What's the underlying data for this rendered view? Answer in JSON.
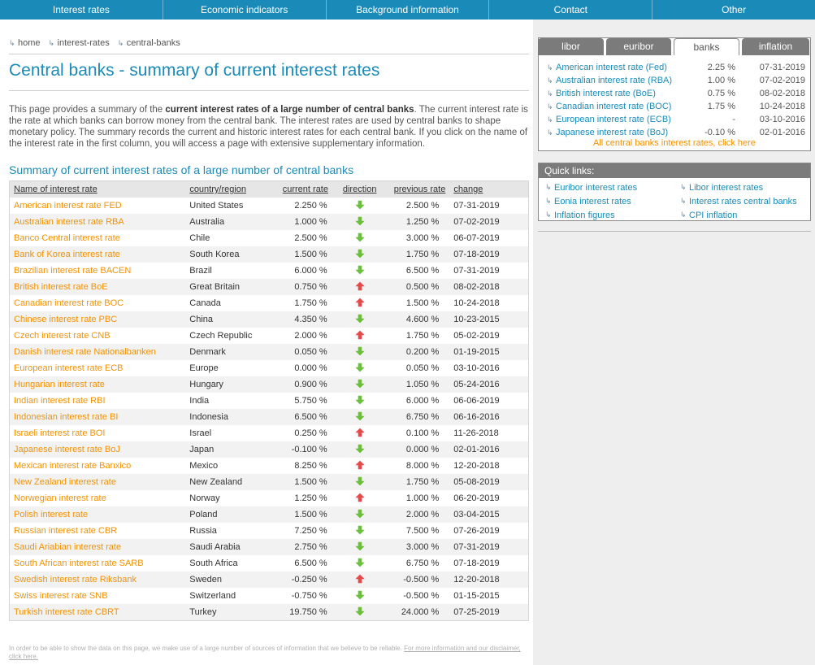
{
  "nav": [
    "Interest rates",
    "Economic indicators",
    "Background information",
    "Contact",
    "Other"
  ],
  "breadcrumb": [
    "home",
    "interest-rates",
    "central-banks"
  ],
  "page_title": "Central banks - summary of current interest rates",
  "intro": {
    "p1": "This page provides a summary of the ",
    "b1": "current interest rates of a large number of central banks",
    "p2": ". The current interest rate is the rate at which banks can borrow money from the central bank. The interest rates are used by central banks to shape monetary policy. The summary records the current and historic interest rates for each central bank. If you click on the name of the interest rate in the first column, you will access a page with extensive supplementary information."
  },
  "section_title": "Summary of current interest rates of a large number of central banks",
  "table": {
    "headers": [
      "Name of interest rate",
      "country/region",
      "current rate",
      "direction",
      "previous rate",
      "change"
    ],
    "rows": [
      {
        "name": "American interest rate FED",
        "country": "United States",
        "current": "2.250 %",
        "dir": "down",
        "previous": "2.500 %",
        "change": "07-31-2019"
      },
      {
        "name": "Australian interest rate RBA",
        "country": "Australia",
        "current": "1.000 %",
        "dir": "down",
        "previous": "1.250 %",
        "change": "07-02-2019"
      },
      {
        "name": "Banco Central interest rate",
        "country": "Chile",
        "current": "2.500 %",
        "dir": "down",
        "previous": "3.000 %",
        "change": "06-07-2019"
      },
      {
        "name": "Bank of Korea interest rate",
        "country": "South Korea",
        "current": "1.500 %",
        "dir": "down",
        "previous": "1.750 %",
        "change": "07-18-2019"
      },
      {
        "name": "Brazilian interest rate BACEN",
        "country": "Brazil",
        "current": "6.000 %",
        "dir": "down",
        "previous": "6.500 %",
        "change": "07-31-2019"
      },
      {
        "name": "British interest rate BoE",
        "country": "Great Britain",
        "current": "0.750 %",
        "dir": "up",
        "previous": "0.500 %",
        "change": "08-02-2018"
      },
      {
        "name": "Canadian interest rate BOC",
        "country": "Canada",
        "current": "1.750 %",
        "dir": "up",
        "previous": "1.500 %",
        "change": "10-24-2018"
      },
      {
        "name": "Chinese interest rate PBC",
        "country": "China",
        "current": "4.350 %",
        "dir": "down",
        "previous": "4.600 %",
        "change": "10-23-2015"
      },
      {
        "name": "Czech interest rate CNB",
        "country": "Czech Republic",
        "current": "2.000 %",
        "dir": "up",
        "previous": "1.750 %",
        "change": "05-02-2019"
      },
      {
        "name": "Danish interest rate Nationalbanken",
        "country": "Denmark",
        "current": "0.050 %",
        "dir": "down",
        "previous": "0.200 %",
        "change": "01-19-2015"
      },
      {
        "name": "European interest rate ECB",
        "country": "Europe",
        "current": "0.000 %",
        "dir": "down",
        "previous": "0.050 %",
        "change": "03-10-2016"
      },
      {
        "name": "Hungarian interest rate",
        "country": "Hungary",
        "current": "0.900 %",
        "dir": "down",
        "previous": "1.050 %",
        "change": "05-24-2016"
      },
      {
        "name": "Indian interest rate RBI",
        "country": "India",
        "current": "5.750 %",
        "dir": "down",
        "previous": "6.000 %",
        "change": "06-06-2019"
      },
      {
        "name": "Indonesian interest rate BI",
        "country": "Indonesia",
        "current": "6.500 %",
        "dir": "down",
        "previous": "6.750 %",
        "change": "06-16-2016"
      },
      {
        "name": "Israeli interest rate BOI",
        "country": "Israel",
        "current": "0.250 %",
        "dir": "up",
        "previous": "0.100 %",
        "change": "11-26-2018"
      },
      {
        "name": "Japanese interest rate BoJ",
        "country": "Japan",
        "current": "-0.100 %",
        "dir": "down",
        "previous": "0.000 %",
        "change": "02-01-2016"
      },
      {
        "name": "Mexican interest rate Banxico",
        "country": "Mexico",
        "current": "8.250 %",
        "dir": "up",
        "previous": "8.000 %",
        "change": "12-20-2018"
      },
      {
        "name": "New Zealand interest rate",
        "country": "New Zealand",
        "current": "1.500 %",
        "dir": "down",
        "previous": "1.750 %",
        "change": "05-08-2019"
      },
      {
        "name": "Norwegian interest rate",
        "country": "Norway",
        "current": "1.250 %",
        "dir": "up",
        "previous": "1.000 %",
        "change": "06-20-2019"
      },
      {
        "name": "Polish interest rate",
        "country": "Poland",
        "current": "1.500 %",
        "dir": "down",
        "previous": "2.000 %",
        "change": "03-04-2015"
      },
      {
        "name": "Russian interest rate CBR",
        "country": "Russia",
        "current": "7.250 %",
        "dir": "down",
        "previous": "7.500 %",
        "change": "07-26-2019"
      },
      {
        "name": "Saudi Ariabian interest rate",
        "country": "Saudi Arabia",
        "current": "2.750 %",
        "dir": "down",
        "previous": "3.000 %",
        "change": "07-31-2019"
      },
      {
        "name": "South African interest rate SARB",
        "country": "South Africa",
        "current": "6.500 %",
        "dir": "down",
        "previous": "6.750 %",
        "change": "07-18-2019"
      },
      {
        "name": "Swedish interest rate Riksbank",
        "country": "Sweden",
        "current": "-0.250 %",
        "dir": "up",
        "previous": "-0.500 %",
        "change": "12-20-2018"
      },
      {
        "name": "Swiss interest rate SNB",
        "country": "Switzerland",
        "current": "-0.750 %",
        "dir": "down",
        "previous": "-0.500 %",
        "change": "01-15-2015"
      },
      {
        "name": "Turkish interest rate CBRT",
        "country": "Turkey",
        "current": "19.750 %",
        "dir": "down",
        "previous": "24.000 %",
        "change": "07-25-2019"
      }
    ]
  },
  "disclaimer": {
    "text": "In order to be able to show the data on this page, we make use of a large number of sources of information that we believe to be reliable. ",
    "link": "For more information and our disclaimer, click here."
  },
  "widget": {
    "tabs": [
      "libor",
      "euribor",
      "banks",
      "inflation"
    ],
    "active_tab": "banks",
    "rows": [
      {
        "name": "American interest rate (Fed)",
        "value": "2.25 %",
        "date": "07-31-2019"
      },
      {
        "name": "Australian interest rate (RBA)",
        "value": "1.00 %",
        "date": "07-02-2019"
      },
      {
        "name": "British interest rate (BoE)",
        "value": "0.75 %",
        "date": "08-02-2018"
      },
      {
        "name": "Canadian interest rate (BOC)",
        "value": "1.75 %",
        "date": "10-24-2018"
      },
      {
        "name": "European interest rate (ECB)",
        "value": "-",
        "date": "03-10-2016"
      },
      {
        "name": "Japanese interest rate (BoJ)",
        "value": "-0.10 %",
        "date": "02-01-2016"
      }
    ],
    "all_link": "All central banks interest rates, click here"
  },
  "quick_links": {
    "title": "Quick links:",
    "items": [
      "Euribor interest rates",
      "Libor interest rates",
      "Eonia interest rates",
      "Interest rates central banks",
      "Inflation figures",
      "CPI inflation"
    ]
  },
  "colors": {
    "nav": "#1a8bb8",
    "link_orange": "#f39200",
    "title_blue": "#1a8bb8",
    "arrow_up": "#e64b4b",
    "arrow_down": "#6abf3c"
  },
  "icons": {
    "up": "arrow-up-icon",
    "down": "arrow-down-icon",
    "bullet": "bullet-arrow-icon"
  }
}
